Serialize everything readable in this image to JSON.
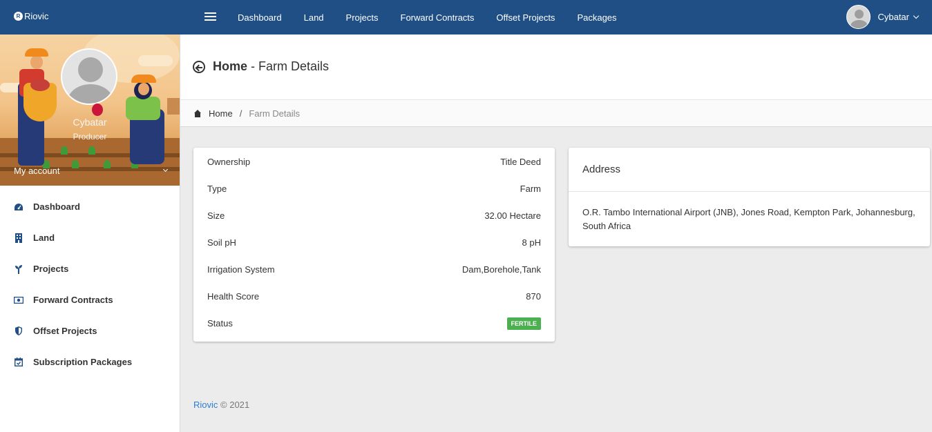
{
  "app": {
    "brand": "Riovic",
    "brand_logo_glyph": "R"
  },
  "topnav": {
    "links": [
      "Dashboard",
      "Land",
      "Projects",
      "Forward Contracts",
      "Offset Projects",
      "Packages"
    ],
    "user_name": "Cybatar"
  },
  "sidebar": {
    "profile_name": "Cybatar",
    "profile_role": "Producer",
    "my_account": "My account",
    "items": [
      {
        "label": "Dashboard",
        "icon": "dashboard-icon"
      },
      {
        "label": "Land",
        "icon": "building-icon"
      },
      {
        "label": "Projects",
        "icon": "seedling-icon"
      },
      {
        "label": "Forward Contracts",
        "icon": "money-bill-icon"
      },
      {
        "label": "Offset Projects",
        "icon": "shield-icon"
      },
      {
        "label": "Subscription Packages",
        "icon": "calendar-check-icon"
      }
    ]
  },
  "page": {
    "title_bold": "Home",
    "title_rest": " - Farm Details"
  },
  "breadcrumb": {
    "home": "Home",
    "separator": "/",
    "current": "Farm Details"
  },
  "details": [
    {
      "label": "Ownership",
      "value": "Title Deed"
    },
    {
      "label": "Type",
      "value": "Farm"
    },
    {
      "label": "Size",
      "value": "32.00 Hectare"
    },
    {
      "label": "Soil pH",
      "value": "8 pH"
    },
    {
      "label": "Irrigation System",
      "value": "Dam,Borehole,Tank"
    },
    {
      "label": "Health Score",
      "value": "870"
    }
  ],
  "status": {
    "label": "Status",
    "value": "FERTILE",
    "color": "#4caf50"
  },
  "address": {
    "title": "Address",
    "text": "O.R. Tambo International Airport (JNB), Jones Road, Kempton Park, Johannesburg, South Africa"
  },
  "footer": {
    "brand": "Riovic",
    "copyright": "© 2021"
  },
  "colors": {
    "navbar": "#1f4f85",
    "accent_link": "#2d7dd2"
  }
}
